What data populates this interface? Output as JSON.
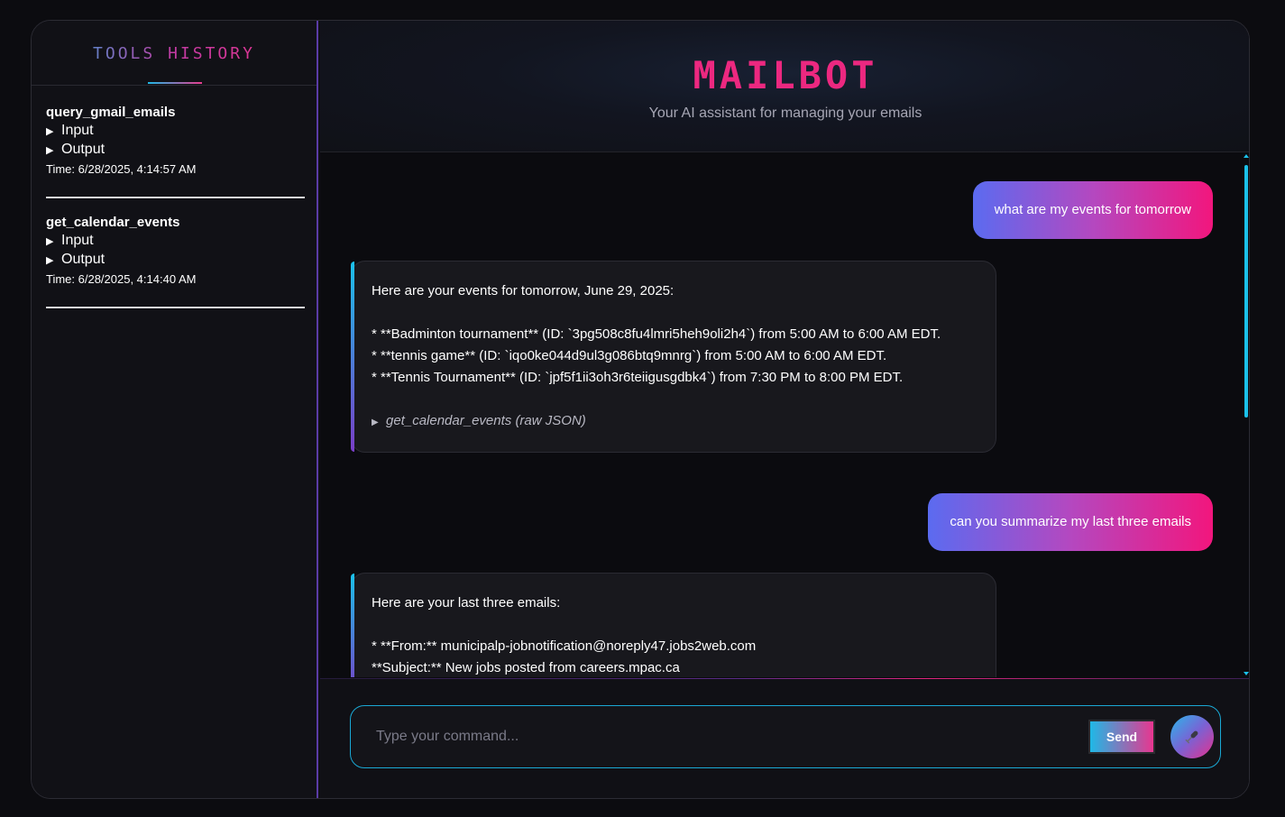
{
  "sidebar": {
    "title": "TOOLS HISTORY",
    "entries": [
      {
        "name": "query_gmail_emails",
        "input_label": "Input",
        "output_label": "Output",
        "time": "Time: 6/28/2025, 4:14:57 AM"
      },
      {
        "name": "get_calendar_events",
        "input_label": "Input",
        "output_label": "Output",
        "time": "Time: 6/28/2025, 4:14:40 AM"
      }
    ]
  },
  "header": {
    "title": "MAILBOT",
    "subtitle": "Your AI assistant for managing your emails"
  },
  "messages": [
    {
      "role": "user",
      "text": "what are my events for tomorrow"
    },
    {
      "role": "bot",
      "intro": "Here are your events for tomorrow, June 29, 2025:",
      "lines": [
        "* **Badminton tournament** (ID: `3pg508c8fu4lmri5heh9oli2h4`) from 5:00 AM to 6:00 AM EDT.",
        "* **tennis game** (ID: `iqo0ke044d9ul3g086btq9mnrg`) from 5:00 AM to 6:00 AM EDT.",
        "* **Tennis Tournament** (ID: `jpf5f1ii3oh3r6teiigusgdbk4`) from 7:30 PM to 8:00 PM EDT."
      ],
      "raw_json_label": "get_calendar_events (raw JSON)"
    },
    {
      "role": "user",
      "text": "can you summarize my last three emails"
    },
    {
      "role": "bot",
      "intro": "Here are your last three emails:",
      "lines": [
        "* **From:** municipalp-jobnotification@noreply47.jobs2web.com",
        "**Subject:** New jobs posted from careers.mpac.ca"
      ]
    }
  ],
  "composer": {
    "placeholder": "Type your command...",
    "send_label": "Send"
  },
  "colors": {
    "accent_pink": "#ec2880",
    "accent_cyan": "#1bc1ea",
    "background": "#0b0b0f"
  }
}
